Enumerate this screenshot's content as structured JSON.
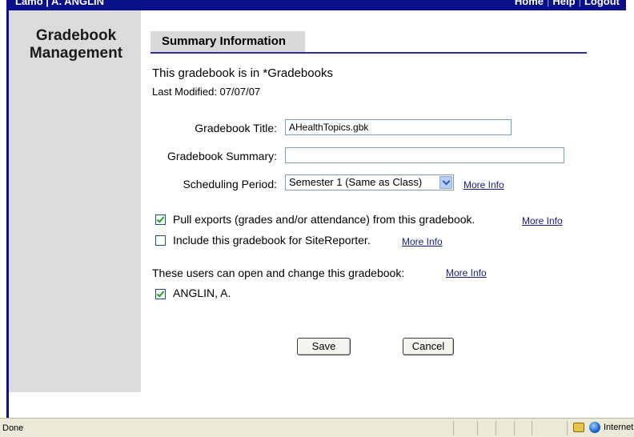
{
  "topbar": {
    "user": "Lamo | A. ANGLIN",
    "links": [
      "Home",
      "Help",
      "Logout"
    ]
  },
  "sidebar": {
    "title_line1": "Gradebook",
    "title_line2": "Management"
  },
  "section": {
    "header": "Summary Information"
  },
  "info": {
    "in_text": "This gradebook is in *Gradebooks",
    "last_modified": "Last Modified:  07/07/07"
  },
  "form": {
    "title_label": "Gradebook Title:",
    "title_value": "AHealthTopics.gbk",
    "summary_label": "Gradebook Summary:",
    "summary_value": "",
    "period_label": "Scheduling Period:",
    "period_value": "Semester 1 (Same as Class)",
    "more_info": "More Info"
  },
  "options": {
    "pull_exports": {
      "label": "Pull exports (grades and/or attendance) from this gradebook.",
      "checked": true
    },
    "site_reporter": {
      "label": "Include this gradebook for SiteReporter.",
      "checked": false
    }
  },
  "users": {
    "heading": "These users can open and change this gradebook:",
    "list": [
      {
        "name": "ANGLIN, A.",
        "checked": true
      }
    ]
  },
  "buttons": {
    "save": "Save",
    "cancel": "Cancel"
  },
  "statusbar": {
    "status": "Done",
    "zone": "Internet"
  }
}
